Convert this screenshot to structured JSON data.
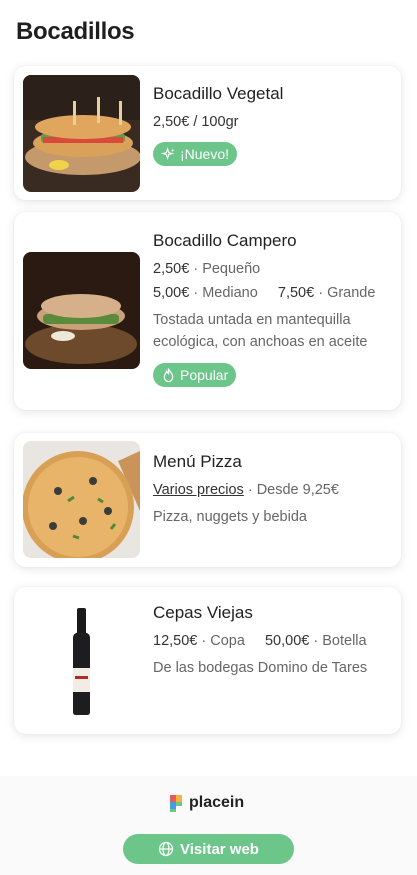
{
  "page": {
    "title": "Bocadillos"
  },
  "items": [
    {
      "name": "Bocadillo Vegetal",
      "price_line": "2,50€  /  100gr",
      "badge": "¡Nuevo!",
      "badge_icon": "sparkle-icon"
    },
    {
      "name": "Bocadillo Campero",
      "price1": "2,50€",
      "size1": "Pequeño",
      "price2": "5,00€",
      "size2": "Mediano",
      "price3": "7,50€",
      "size3": "Grande",
      "description": "Tostada untada en mantequilla ecológica, con anchoas en aceite",
      "badge": "Popular",
      "badge_icon": "flame-icon"
    },
    {
      "name": "Menú Pizza",
      "link_text": "Varios precios",
      "from_text": "Desde 9,25€",
      "description": "Pizza, nuggets y bebida"
    },
    {
      "name": "Cepas Viejas",
      "price1": "12,50€",
      "size1": "Copa",
      "price2": "50,00€",
      "size2": "Botella",
      "description": "De las bodegas Domino de Tares"
    }
  ],
  "footer": {
    "brand": "placein",
    "visit_label": "Visitar web",
    "visit_icon": "globe-icon"
  },
  "colors": {
    "accent": "#6cc68a",
    "text": "#222222",
    "muted": "#666666"
  }
}
